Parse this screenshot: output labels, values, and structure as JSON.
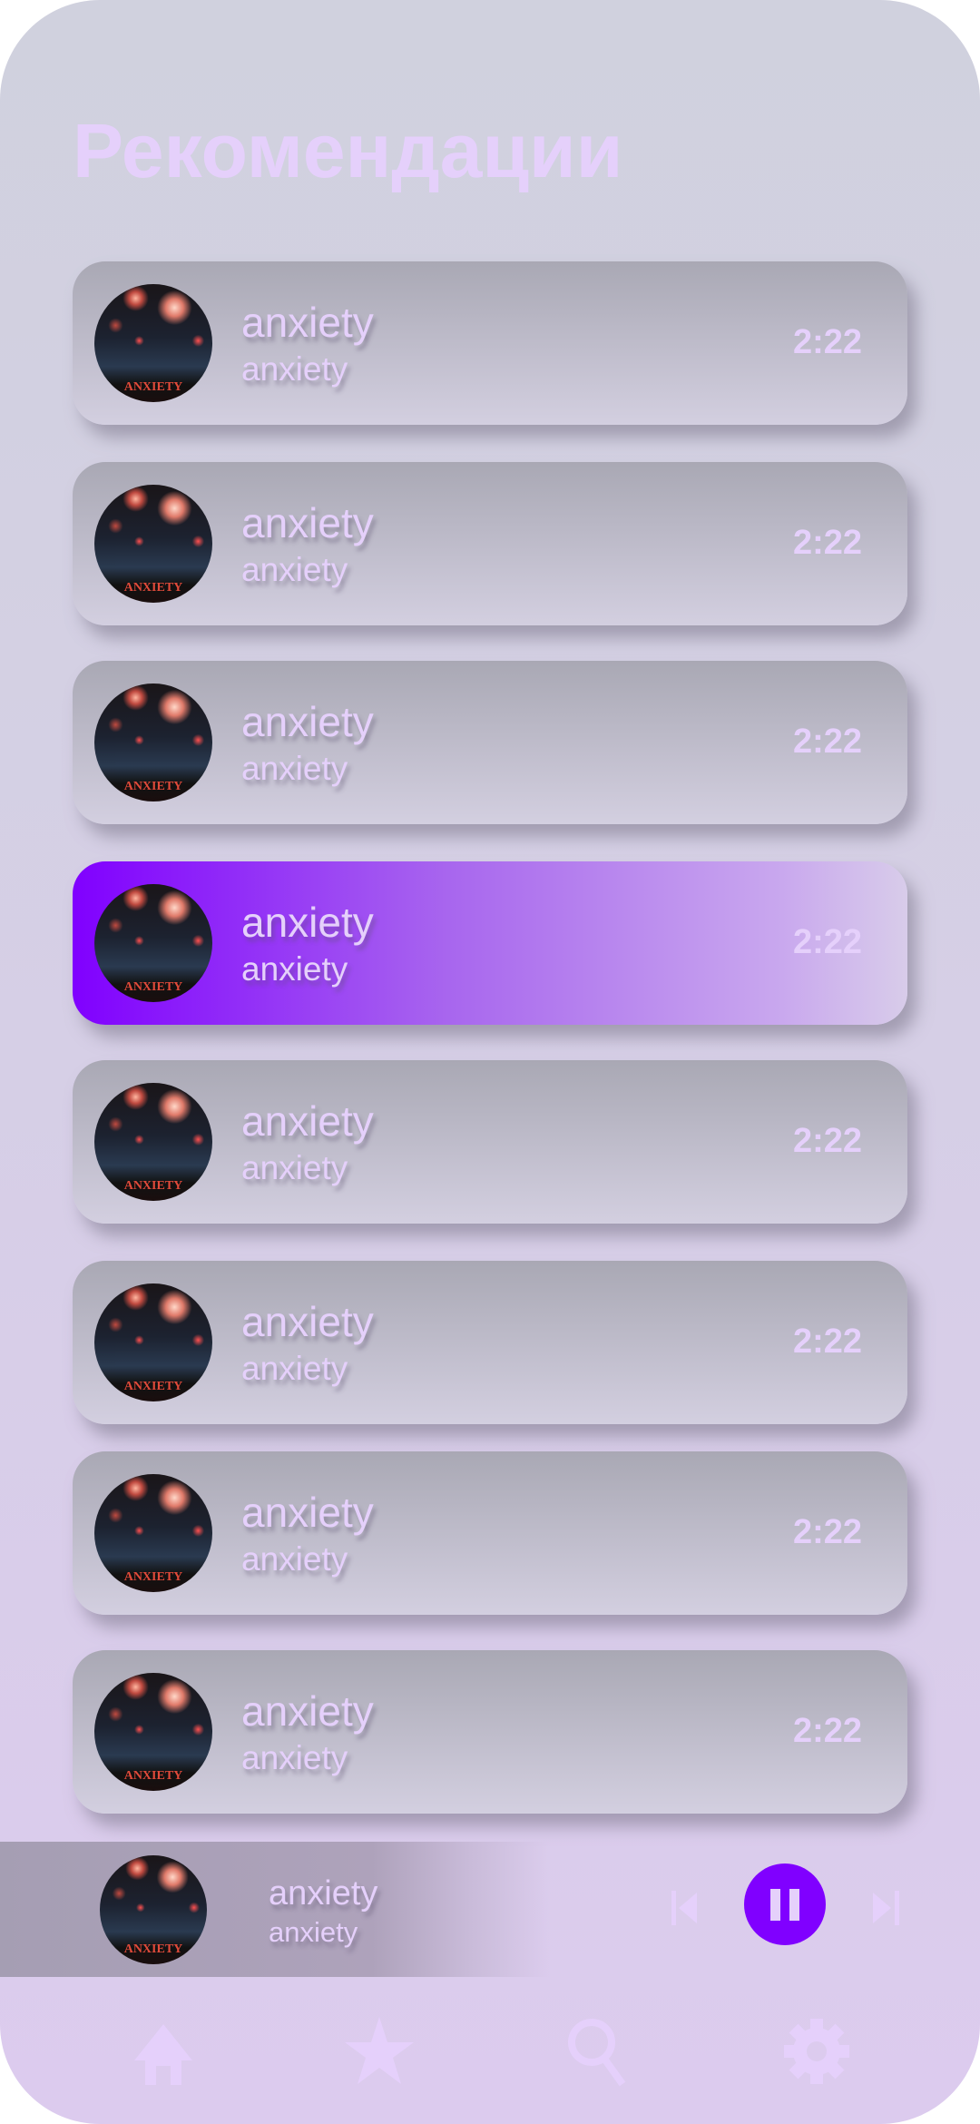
{
  "header": {
    "title": "Рекомендации"
  },
  "tracks": [
    {
      "title": "anxiety",
      "artist": "anxiety",
      "duration": "2:22",
      "active": false
    },
    {
      "title": "anxiety",
      "artist": "anxiety",
      "duration": "2:22",
      "active": false
    },
    {
      "title": "anxiety",
      "artist": "anxiety",
      "duration": "2:22",
      "active": false
    },
    {
      "title": "anxiety",
      "artist": "anxiety",
      "duration": "2:22",
      "active": true
    },
    {
      "title": "anxiety",
      "artist": "anxiety",
      "duration": "2:22",
      "active": false
    },
    {
      "title": "anxiety",
      "artist": "anxiety",
      "duration": "2:22",
      "active": false
    },
    {
      "title": "anxiety",
      "artist": "anxiety",
      "duration": "2:22",
      "active": false
    },
    {
      "title": "anxiety",
      "artist": "anxiety",
      "duration": "2:22",
      "active": false
    }
  ],
  "album_art_text": "ANXIETY",
  "player": {
    "title": "anxiety",
    "artist": "anxiety",
    "state": "playing"
  },
  "nav": [
    {
      "icon": "home-icon"
    },
    {
      "icon": "star-icon"
    },
    {
      "icon": "search-icon"
    },
    {
      "icon": "gear-icon"
    }
  ],
  "colors": {
    "accent": "#8000ff",
    "text": "#e5d0fb"
  }
}
